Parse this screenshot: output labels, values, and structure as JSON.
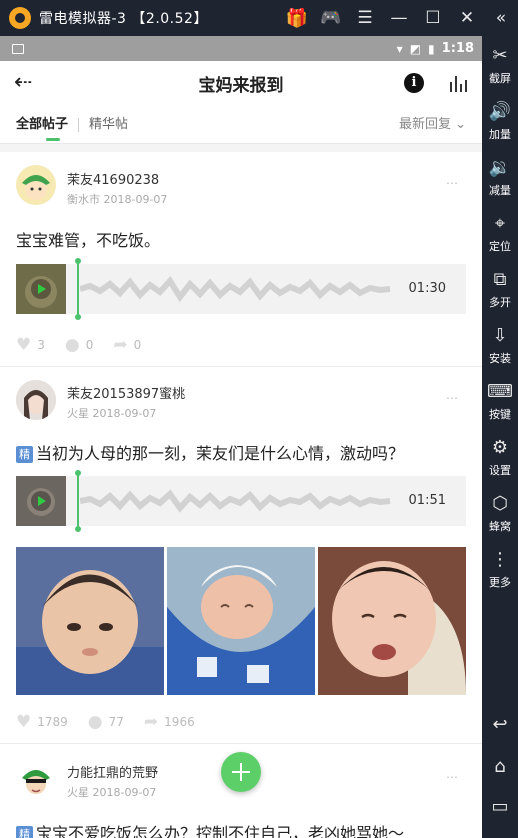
{
  "emulator": {
    "title": "雷电模拟器-3 【2.0.52】",
    "sidebar": [
      {
        "label": "截屏",
        "icon": "scissors-icon"
      },
      {
        "label": "加量",
        "icon": "volume-up-icon"
      },
      {
        "label": "减量",
        "icon": "volume-down-icon"
      },
      {
        "label": "定位",
        "icon": "location-pin-icon"
      },
      {
        "label": "多开",
        "icon": "multi-window-icon"
      },
      {
        "label": "安装",
        "icon": "apk-install-icon"
      },
      {
        "label": "按键",
        "icon": "keyboard-icon"
      },
      {
        "label": "设置",
        "icon": "gear-icon"
      },
      {
        "label": "蜂窝",
        "icon": "hive-icon"
      },
      {
        "label": "更多",
        "icon": "more-dots-icon"
      }
    ]
  },
  "status": {
    "time": "1:18"
  },
  "header": {
    "title": "宝妈来报到"
  },
  "tabs": {
    "all": "全部帖子",
    "featured": "精华帖",
    "sort": "最新回复"
  },
  "posts": [
    {
      "author": "茉友41690238",
      "location": "衡水市",
      "date": "2018-09-07",
      "text": "宝宝难管，不吃饭。",
      "duration": "01:30",
      "likes": "3",
      "comments": "0",
      "shares": "0"
    },
    {
      "author": "茉友20153897蜜桃",
      "location": "火星",
      "date": "2018-09-07",
      "badge": "精",
      "text": "当初为人母的那一刻，茉友们是什么心情，激动吗？",
      "duration": "01:51",
      "likes": "1789",
      "comments": "77",
      "shares": "1966"
    },
    {
      "author": "力能扛鼎的荒野",
      "location": "火星",
      "date": "2018-09-07",
      "badge": "精",
      "text": "宝宝不爱吃饭怎么办？控制不住自己，老凶她骂她～"
    }
  ],
  "colors": {
    "accent": "#4cc26c",
    "badge": "#5b8fd4",
    "emulator_chrome": "#1e2430"
  }
}
